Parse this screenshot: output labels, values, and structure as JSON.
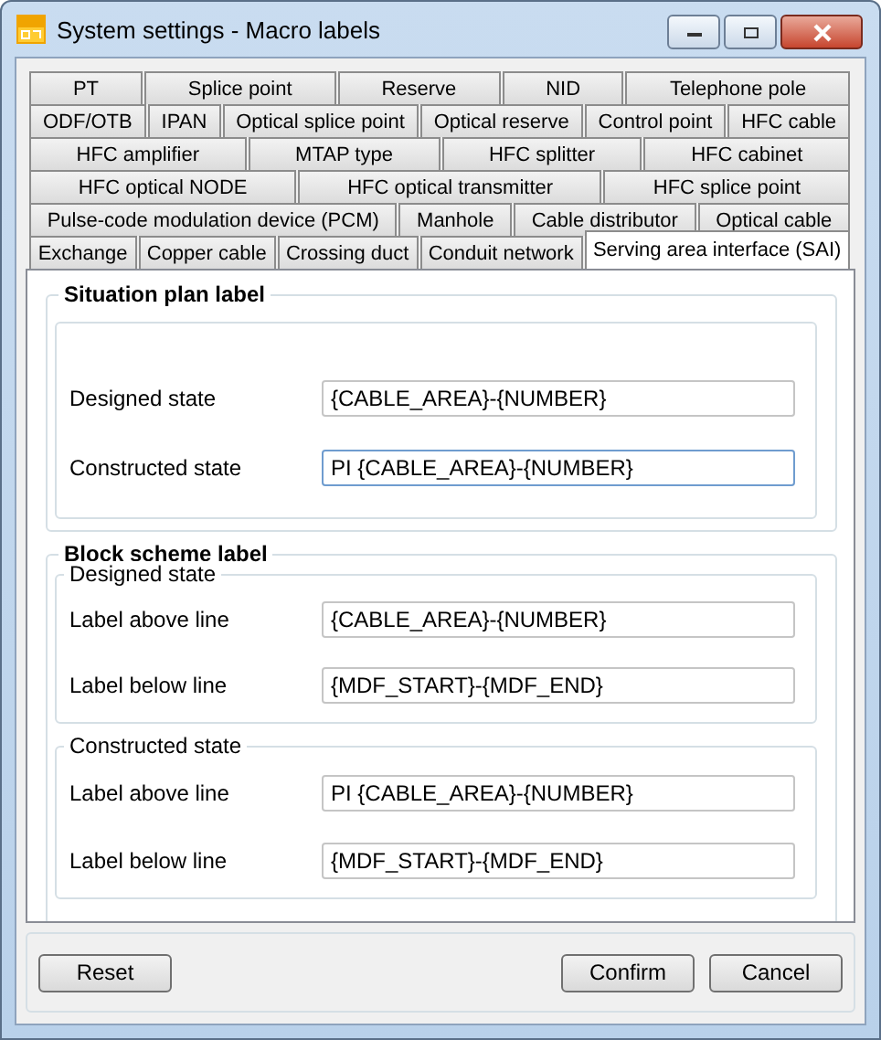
{
  "window": {
    "title": "System settings - Macro labels"
  },
  "tab_rows": [
    [
      {
        "label": "PT",
        "selected": false
      },
      {
        "label": "Splice point",
        "selected": false
      },
      {
        "label": "Reserve",
        "selected": false
      },
      {
        "label": "NID",
        "selected": false
      },
      {
        "label": "Telephone pole",
        "selected": false
      }
    ],
    [
      {
        "label": "ODF/OTB",
        "selected": false
      },
      {
        "label": "IPAN",
        "selected": false
      },
      {
        "label": "Optical splice point",
        "selected": false
      },
      {
        "label": "Optical reserve",
        "selected": false
      },
      {
        "label": "Control point",
        "selected": false
      },
      {
        "label": "HFC cable",
        "selected": false
      }
    ],
    [
      {
        "label": "HFC amplifier",
        "selected": false
      },
      {
        "label": "MTAP type",
        "selected": false
      },
      {
        "label": "HFC splitter",
        "selected": false
      },
      {
        "label": "HFC cabinet",
        "selected": false
      }
    ],
    [
      {
        "label": "HFC optical NODE",
        "selected": false
      },
      {
        "label": "HFC optical transmitter",
        "selected": false
      },
      {
        "label": "HFC splice point",
        "selected": false
      }
    ],
    [
      {
        "label": "Pulse-code modulation device (PCM)",
        "selected": false
      },
      {
        "label": "Manhole",
        "selected": false
      },
      {
        "label": "Cable distributor",
        "selected": false
      },
      {
        "label": "Optical cable",
        "selected": false
      }
    ],
    [
      {
        "label": "Exchange",
        "selected": false
      },
      {
        "label": "Copper cable",
        "selected": false
      },
      {
        "label": "Crossing duct",
        "selected": false
      },
      {
        "label": "Conduit network",
        "selected": false
      },
      {
        "label": "Serving area interface (SAI)",
        "selected": true
      }
    ]
  ],
  "situation_plan": {
    "title": "Situation plan label",
    "fields": [
      {
        "label": "Designed state",
        "value": "{CABLE_AREA}-{NUMBER}",
        "focused": false
      },
      {
        "label": "Constructed state",
        "value": "PI {CABLE_AREA}-{NUMBER}",
        "focused": true
      }
    ]
  },
  "block_scheme": {
    "title": "Block scheme label",
    "groups": [
      {
        "title": "Designed state",
        "fields": [
          {
            "label": "Label above line",
            "value": "{CABLE_AREA}-{NUMBER}",
            "focused": false
          },
          {
            "label": "Label below line",
            "value": "{MDF_START}-{MDF_END}",
            "focused": false
          }
        ]
      },
      {
        "title": "Constructed state",
        "fields": [
          {
            "label": "Label above line",
            "value": "PI {CABLE_AREA}-{NUMBER}",
            "focused": false
          },
          {
            "label": "Label below line",
            "value": "{MDF_START}-{MDF_END}",
            "focused": false
          }
        ]
      }
    ]
  },
  "buttons": {
    "left": [
      {
        "label": "Reset"
      }
    ],
    "right": [
      {
        "label": "Confirm"
      },
      {
        "label": "Cancel"
      }
    ]
  }
}
